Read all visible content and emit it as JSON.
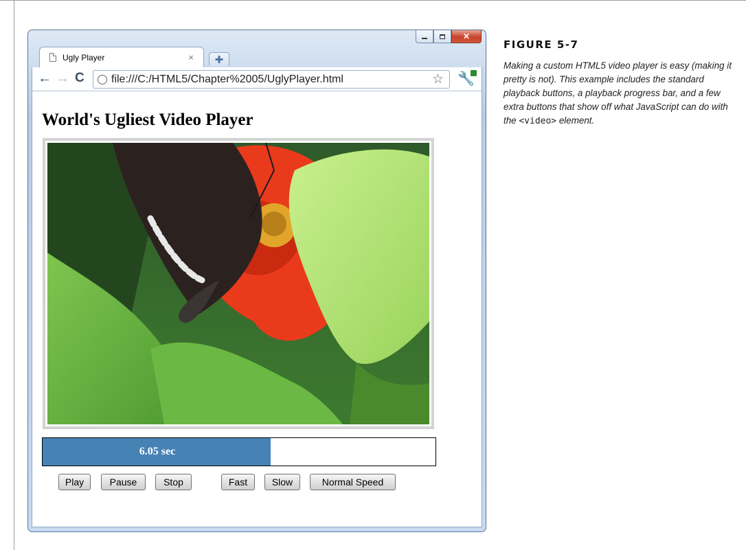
{
  "browser": {
    "tab": {
      "title": "Ugly Player",
      "close_glyph": "×",
      "new_tab_glyph": "✚"
    },
    "window_controls": {
      "minimize": "minimize-icon",
      "maximize": "maximize-icon",
      "close": "✕"
    },
    "toolbar": {
      "back_glyph": "←",
      "forward_glyph": "→",
      "reload_glyph": "C",
      "url": "file:///C:/HTML5/Chapter%2005/UglyPlayer.html",
      "bookmark_glyph": "☆",
      "wrench_glyph": "🔧"
    }
  },
  "page": {
    "title": "World's Ugliest Video Player",
    "video": {
      "description_icon": "video-frame"
    },
    "progress": {
      "text": "6.05 sec",
      "fraction": 0.58,
      "fill_color": "#4682b4"
    },
    "buttons": [
      {
        "label": "Play"
      },
      {
        "label": "Pause"
      },
      {
        "label": "Stop"
      },
      {
        "label": "Fast"
      },
      {
        "label": "Slow"
      },
      {
        "label": "Normal Speed"
      }
    ]
  },
  "figure": {
    "label": "FIGURE 5-7",
    "caption_before": "Making a custom HTML5 video player is easy (making it pretty is not). This example includes the standard playback buttons, a playback progress bar, and a few extra buttons that show off what JavaScript can do with the ",
    "caption_code": "<video>",
    "caption_after": " element."
  }
}
